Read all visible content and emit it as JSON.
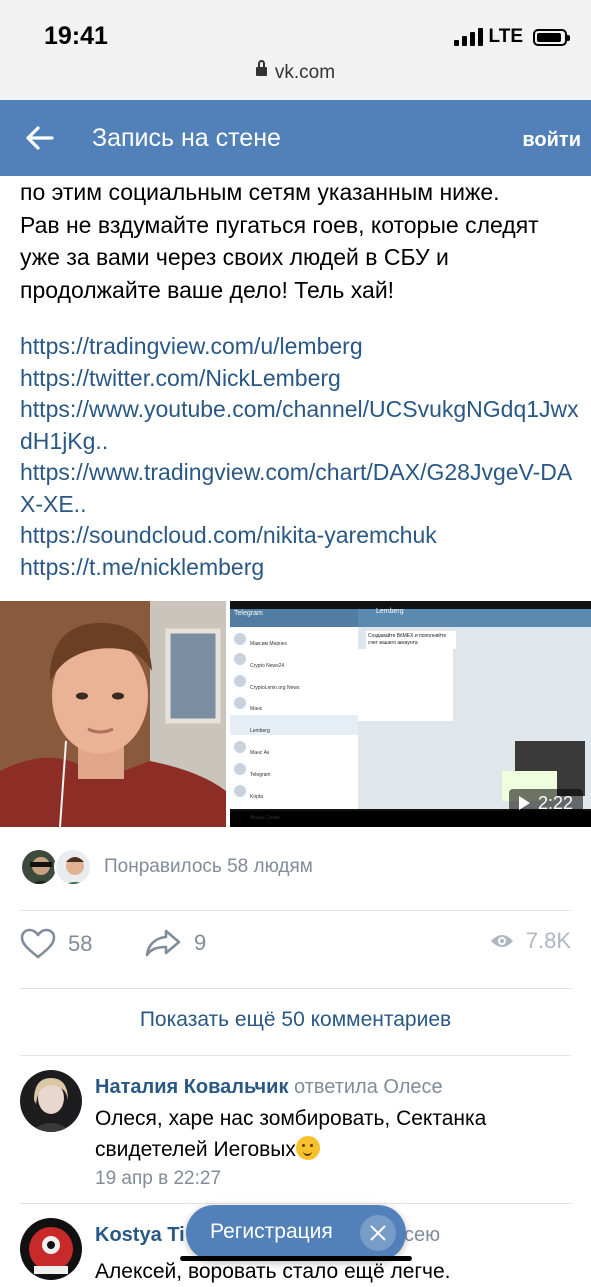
{
  "status": {
    "time": "19:41",
    "network": "LTE"
  },
  "browser": {
    "url": "vk.com"
  },
  "nav": {
    "title": "Запись на стене",
    "login": "войти"
  },
  "post": {
    "text": "по этим социальным сетям указанным ниже.\nРав не вздумайте пугаться гоев, которые следят уже за вами через своих людей в СБУ и продолжайте ваше дело! Тель хай!",
    "links": [
      "https://tradingview.com/u/lemberg",
      "https://twitter.com/NickLemberg",
      "https://www.youtube.com/channel/UCSvukgNGdq1JwxdH1jKg..",
      "https://www.tradingview.com/chart/DAX/G28JvgeV-DAX-XE..",
      "https://soundcloud.com/nikita-yaremchuk",
      "https://t.me/nicklemberg"
    ],
    "video": {
      "duration": "2:22",
      "app_title": "Telegram",
      "chat_title": "Lemberg",
      "chat_list": [
        "Максим Мернес",
        "Crypto News24",
        "CryptoLenin.org News",
        "Манс",
        "Lemberg",
        "Манс Ак",
        "Telegram",
        "Kripta",
        "Миша Сумин"
      ],
      "message": "Создавайте BitMEX и пополняйте счет вашего аккаунта"
    }
  },
  "likes_line": "Понравилось 58 людям",
  "stats": {
    "likes": "58",
    "shares": "9",
    "views": "7.8K"
  },
  "more_comments": "Показать ещё 50 комментариев",
  "comments": [
    {
      "author": "Наталия Ковальчик",
      "reply_to": "ответила Олесе",
      "text": "Олеся, харе нас зомбировать, Сектанка свидетелей Иеговых",
      "date": "19 апр в 22:27"
    },
    {
      "author": "Kostya Ti",
      "reply_to": "ксею",
      "text": "Алексей, воровать стало ещё легче."
    }
  ],
  "register": {
    "label": "Регистрация"
  },
  "colors": {
    "header": "#5181b8",
    "link": "#2a5885",
    "muted": "#818c99"
  }
}
